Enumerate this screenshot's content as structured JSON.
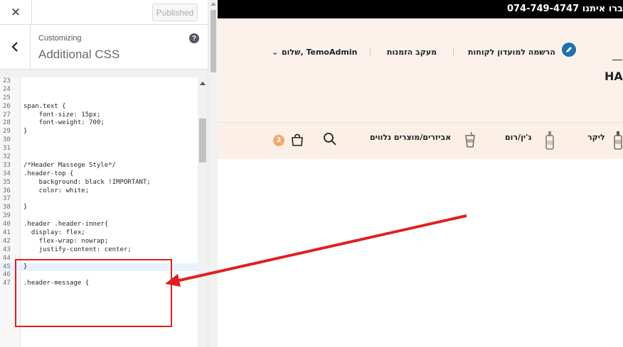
{
  "customizer": {
    "close_glyph": "×",
    "publish_label": "Published",
    "breadcrumb": "Customizing",
    "section_title": "Additional CSS",
    "help_glyph": "?"
  },
  "editor": {
    "lines": [
      {
        "n": "23",
        "code": ""
      },
      {
        "n": "24",
        "code": ""
      },
      {
        "n": "25",
        "code": ""
      },
      {
        "n": "26",
        "code": "span.text {"
      },
      {
        "n": "27",
        "code": "    font-size: 15px;"
      },
      {
        "n": "28",
        "code": "    font-weight: 700;"
      },
      {
        "n": "29",
        "code": "}"
      },
      {
        "n": "30",
        "code": ""
      },
      {
        "n": "31",
        "code": ""
      },
      {
        "n": "32",
        "code": ""
      },
      {
        "n": "33",
        "code": "/*Header Massege Style*/"
      },
      {
        "n": "34",
        "code": ".header-top {"
      },
      {
        "n": "35",
        "code": "    background: black !IMPORTANT;"
      },
      {
        "n": "36",
        "code": "    color: white;"
      },
      {
        "n": "37",
        "code": ""
      },
      {
        "n": "38",
        "code": "}"
      },
      {
        "n": "39",
        "code": ""
      },
      {
        "n": "40",
        "code": ".header .header-inner{"
      },
      {
        "n": "41",
        "code": "  display: flex;"
      },
      {
        "n": "42",
        "code": "    flex-wrap: nowrap;"
      },
      {
        "n": "43",
        "code": "    justify-content: center;"
      },
      {
        "n": "44",
        "code": ""
      },
      {
        "n": "45",
        "code": "}"
      },
      {
        "n": "46",
        "code": ""
      },
      {
        "n": "47",
        "code": ".header-message {"
      }
    ],
    "active_line": "45"
  },
  "site": {
    "phone": "074-749-4747 ברו איתנו",
    "account": {
      "register": "הרשמה למועדון לקוחות",
      "track_order": "מעקב הזמנות",
      "greeting": "שלום, TemoAdmin",
      "chevron": "⌄"
    },
    "logo": "HA",
    "nav": {
      "liqueur": "ליקר",
      "gin_rum": "ג'ין/רום",
      "accessories": "אביזרים/מוצרים נלווים"
    },
    "cart_count": "2"
  },
  "colors": {
    "annotation": "#e02020",
    "accent_blue": "#2271b1",
    "cart_badge": "#f0a96e",
    "header_bg": "#fcf1ea"
  }
}
